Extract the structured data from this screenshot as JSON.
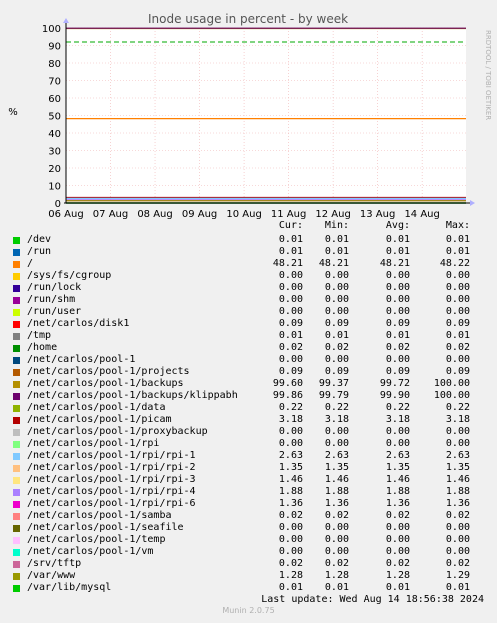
{
  "title": "Inode usage in percent - by week",
  "side_label": "RRDTOOL / TOBI OETIKER",
  "ylabel": "%",
  "headers": {
    "cur": "Cur:",
    "min": "Min:",
    "avg": "Avg:",
    "max": "Max:"
  },
  "last_update": "Last update: Wed Aug 14 18:56:38 2024",
  "footer": "Munin 2.0.75",
  "colors": {
    "background": "#f0f0f0",
    "plot_bg": "#ffffff",
    "grid": "#f0b4b4",
    "axis": "#000000",
    "warning_line": "#00aa00",
    "frame": "#d0d0d0"
  },
  "chart_data": {
    "type": "line",
    "title": "Inode usage in percent - by week",
    "xlabel": "",
    "ylabel": "%",
    "ylim": [
      0,
      100
    ],
    "yticks": [
      0,
      10,
      20,
      30,
      40,
      50,
      60,
      70,
      80,
      90,
      100
    ],
    "x_ticks": [
      "06 Aug",
      "07 Aug",
      "08 Aug",
      "09 Aug",
      "10 Aug",
      "11 Aug",
      "12 Aug",
      "13 Aug",
      "14 Aug"
    ],
    "warning_threshold": 92,
    "grid": true,
    "legend_position": "bottom",
    "series": [
      {
        "name": "/dev",
        "color": "#00cc00",
        "cur": "0.01",
        "min": "0.01",
        "avg": "0.01",
        "max": "0.01"
      },
      {
        "name": "/run",
        "color": "#0066b3",
        "cur": "0.01",
        "min": "0.01",
        "avg": "0.01",
        "max": "0.01"
      },
      {
        "name": "/",
        "color": "#ff8000",
        "cur": "48.21",
        "min": "48.21",
        "avg": "48.21",
        "max": "48.22"
      },
      {
        "name": "/sys/fs/cgroup",
        "color": "#ffcc00",
        "cur": "0.00",
        "min": "0.00",
        "avg": "0.00",
        "max": "0.00"
      },
      {
        "name": "/run/lock",
        "color": "#330099",
        "cur": "0.00",
        "min": "0.00",
        "avg": "0.00",
        "max": "0.00"
      },
      {
        "name": "/run/shm",
        "color": "#990099",
        "cur": "0.00",
        "min": "0.00",
        "avg": "0.00",
        "max": "0.00"
      },
      {
        "name": "/run/user",
        "color": "#ccff00",
        "cur": "0.00",
        "min": "0.00",
        "avg": "0.00",
        "max": "0.00"
      },
      {
        "name": "/net/carlos/disk1",
        "color": "#ff0000",
        "cur": "0.09",
        "min": "0.09",
        "avg": "0.09",
        "max": "0.09"
      },
      {
        "name": "/tmp",
        "color": "#808080",
        "cur": "0.01",
        "min": "0.01",
        "avg": "0.01",
        "max": "0.01"
      },
      {
        "name": "/home",
        "color": "#008f00",
        "cur": "0.02",
        "min": "0.02",
        "avg": "0.02",
        "max": "0.02"
      },
      {
        "name": "/net/carlos/pool-1",
        "color": "#00487d",
        "cur": "0.00",
        "min": "0.00",
        "avg": "0.00",
        "max": "0.00"
      },
      {
        "name": "/net/carlos/pool-1/projects",
        "color": "#b35a00",
        "cur": "0.09",
        "min": "0.09",
        "avg": "0.09",
        "max": "0.09"
      },
      {
        "name": "/net/carlos/pool-1/backups",
        "color": "#b38f00",
        "cur": "99.60",
        "min": "99.37",
        "avg": "99.72",
        "max": "100.00"
      },
      {
        "name": "/net/carlos/pool-1/backups/klippabh",
        "color": "#6b006b",
        "cur": "99.86",
        "min": "99.79",
        "avg": "99.90",
        "max": "100.00"
      },
      {
        "name": "/net/carlos/pool-1/data",
        "color": "#8fb300",
        "cur": "0.22",
        "min": "0.22",
        "avg": "0.22",
        "max": "0.22"
      },
      {
        "name": "/net/carlos/pool-1/picam",
        "color": "#b30000",
        "cur": "3.18",
        "min": "3.18",
        "avg": "3.18",
        "max": "3.18"
      },
      {
        "name": "/net/carlos/pool-1/proxybackup",
        "color": "#bebebe",
        "cur": "0.00",
        "min": "0.00",
        "avg": "0.00",
        "max": "0.00"
      },
      {
        "name": "/net/carlos/pool-1/rpi",
        "color": "#80ff80",
        "cur": "0.00",
        "min": "0.00",
        "avg": "0.00",
        "max": "0.00"
      },
      {
        "name": "/net/carlos/pool-1/rpi/rpi-1",
        "color": "#80c9ff",
        "cur": "2.63",
        "min": "2.63",
        "avg": "2.63",
        "max": "2.63"
      },
      {
        "name": "/net/carlos/pool-1/rpi/rpi-2",
        "color": "#ffc080",
        "cur": "1.35",
        "min": "1.35",
        "avg": "1.35",
        "max": "1.35"
      },
      {
        "name": "/net/carlos/pool-1/rpi/rpi-3",
        "color": "#ffe680",
        "cur": "1.46",
        "min": "1.46",
        "avg": "1.46",
        "max": "1.46"
      },
      {
        "name": "/net/carlos/pool-1/rpi/rpi-4",
        "color": "#aa80ff",
        "cur": "1.88",
        "min": "1.88",
        "avg": "1.88",
        "max": "1.88"
      },
      {
        "name": "/net/carlos/pool-1/rpi/rpi-6",
        "color": "#ee00cc",
        "cur": "1.36",
        "min": "1.36",
        "avg": "1.36",
        "max": "1.36"
      },
      {
        "name": "/net/carlos/pool-1/samba",
        "color": "#ff8080",
        "cur": "0.02",
        "min": "0.02",
        "avg": "0.02",
        "max": "0.02"
      },
      {
        "name": "/net/carlos/pool-1/seafile",
        "color": "#666600",
        "cur": "0.00",
        "min": "0.00",
        "avg": "0.00",
        "max": "0.00"
      },
      {
        "name": "/net/carlos/pool-1/temp",
        "color": "#ffbfff",
        "cur": "0.00",
        "min": "0.00",
        "avg": "0.00",
        "max": "0.00"
      },
      {
        "name": "/net/carlos/pool-1/vm",
        "color": "#00ffcc",
        "cur": "0.00",
        "min": "0.00",
        "avg": "0.00",
        "max": "0.00"
      },
      {
        "name": "/srv/tftp",
        "color": "#cc6699",
        "cur": "0.02",
        "min": "0.02",
        "avg": "0.02",
        "max": "0.02"
      },
      {
        "name": "/var/www",
        "color": "#999900",
        "cur": "1.28",
        "min": "1.28",
        "avg": "1.28",
        "max": "1.29"
      },
      {
        "name": "/var/lib/mysql",
        "color": "#00cc00",
        "cur": "0.01",
        "min": "0.01",
        "avg": "0.01",
        "max": "0.01"
      }
    ]
  }
}
